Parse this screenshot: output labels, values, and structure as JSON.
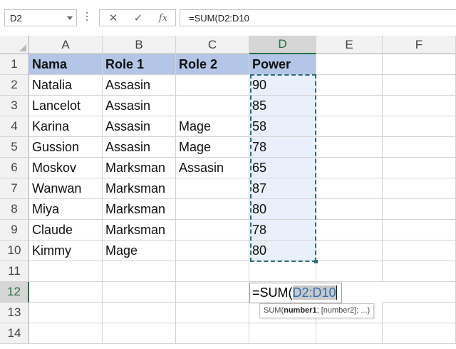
{
  "formula_bar": {
    "name_box": "D2",
    "cancel_glyph": "✕",
    "enter_glyph": "✓",
    "fx_label": "fx",
    "formula": "=SUM(D2:D10"
  },
  "columns": [
    "A",
    "B",
    "C",
    "D",
    "E",
    "F"
  ],
  "rows": [
    "1",
    "2",
    "3",
    "4",
    "5",
    "6",
    "7",
    "8",
    "9",
    "10",
    "11",
    "12",
    "13",
    "14"
  ],
  "table": {
    "headers": [
      "Nama",
      "Role 1",
      "Role 2",
      "Power"
    ],
    "records": [
      [
        "Natalia",
        "Assasin",
        "",
        "90"
      ],
      [
        "Lancelot",
        "Assasin",
        "",
        "85"
      ],
      [
        "Karina",
        "Assasin",
        "Mage",
        "58"
      ],
      [
        "Gussion",
        "Assasin",
        "Mage",
        "78"
      ],
      [
        "Moskov",
        "Marksman",
        "Assasin",
        "65"
      ],
      [
        "Wanwan",
        "Marksman",
        "",
        "87"
      ],
      [
        "Miya",
        "Marksman",
        "",
        "80"
      ],
      [
        "Claude",
        "Marksman",
        "",
        "78"
      ],
      [
        "Kimmy",
        "Mage",
        "",
        "80"
      ]
    ]
  },
  "edit_cell": {
    "prefix": "=SUM(",
    "reference": "D2:D10"
  },
  "tooltip": {
    "func": "SUM(",
    "arg1": "number1",
    "rest": "; [number2]; ...)"
  },
  "colors": {
    "header_fill": "#b4c6e7",
    "range_fill": "#eaf0fb",
    "range_border": "#2f6a7a",
    "reference_text": "#2e6fb7",
    "selected_header": "#217346"
  }
}
